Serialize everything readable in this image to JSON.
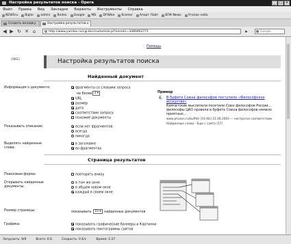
{
  "window": {
    "title": "Настройка результатов поиска - Opera"
  },
  "menu": [
    "Файл",
    "Правка",
    "Вид",
    "Закладки",
    "Виджеты",
    "Инструменты",
    "Справка"
  ],
  "bookmarks": [
    "NEWSru",
    "Bigler",
    "admin",
    "Яndex",
    "Google",
    "МБ",
    "DFWike",
    "Kramer",
    "Апорт Лайт",
    "ВПК-News",
    "Уголок небо"
  ],
  "tabs": [
    {
      "label": "Создать вкладку"
    },
    {
      "label": "Настройка результатов..."
    }
  ],
  "address": {
    "url": "http://www.yandex.ru/cgi-bin/customize.pl?noredir=3489462771",
    "search_placeholder": "Google"
  },
  "page": {
    "help_link": "Помощь",
    "logo": "[ЯКБ]",
    "title": "Настройка результатов поиска",
    "found_doc_heading": "Найденный документ",
    "info_label": "Информация о документе:",
    "info_fragments": "фрагменты со словами запроса",
    "info_not_more": "не более",
    "info_count": "3",
    "info_options": [
      "URL",
      "размер",
      "дата",
      "соответствие запросу",
      "похожие документы"
    ],
    "desc_label": "Показывать описание:",
    "desc_options": [
      "если нет фрагментов",
      "всегда",
      "никогда"
    ],
    "highlight_label": "Выделять найденные слова:",
    "highlight_options": [
      "в заголовке",
      "во фрагментах"
    ],
    "example": {
      "label": "Пример",
      "num": "6.",
      "link": "В буфете Союза философов поступило «Философское исскуство»",
      "snippet": "Камчатские мыслители посетили Союз философов России... философы ЦАО провели в буфете Союза философов немало приятных...",
      "url": "www.phussn.ru/buffet/ (16 КБ) 21.06.2003 — нестрогое соответствие",
      "foot": "Найденные слова - Еще с сайта (57)"
    },
    "results_heading": "Страница результатов",
    "form_label": "Поисковая форма:",
    "form_option": "повторять внизу",
    "open_label": "Открывать найденные документы:",
    "open_options": [
      "в том же окне",
      "в общем новом окне",
      "каждый в своем окне"
    ],
    "size_label": "Размер страницы:",
    "size_prefix": "показывать",
    "size_value": "10",
    "size_suffix": "найденных документов",
    "graphics_label": "Графика:",
    "graphics_options": [
      "показывать графические баннеры и Картинки",
      "показывать пиктограммы сайтов"
    ]
  },
  "status": {
    "security": "Загрузить: 9/9",
    "size": "Всего: 0 Б",
    "speed": "Скорость: 0 Б/с",
    "time": "Время: 1:27"
  }
}
